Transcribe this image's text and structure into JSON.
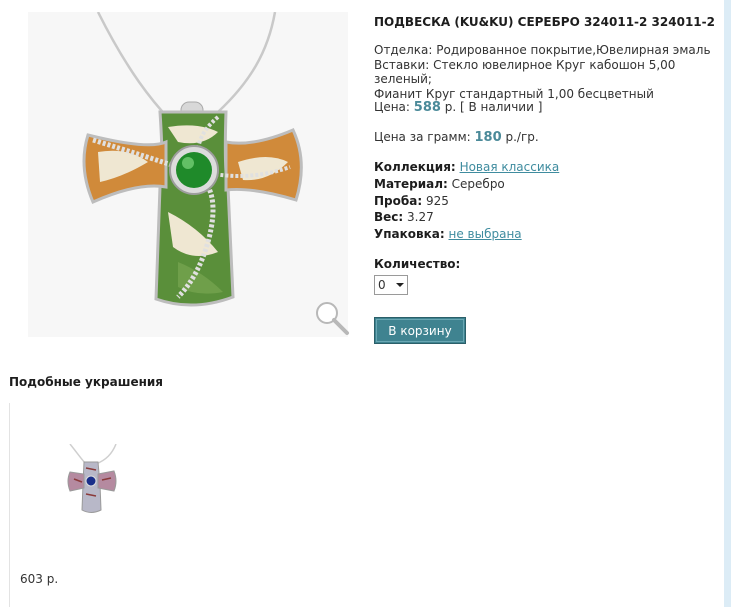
{
  "product": {
    "title": "ПОДВЕСКА (KU&KU) СЕРЕБРО 324011-2 324011-2",
    "finish_line": "Отделка: Родированное покрытие,Ювелирная эмаль",
    "inserts_line1": "Вставки: Стекло ювелирное Круг кабошон 5,00 зеленый;",
    "inserts_line2": "Фианит Круг стандартный 1,00 бесцветный",
    "price_label": "Цена:",
    "price_value": "588",
    "price_suffix": "р. [ В наличии ]",
    "per_gram_label": "Цена за грамм:",
    "per_gram_value": "180",
    "per_gram_suffix": "р./гр.",
    "props": {
      "collection_label": "Коллекция:",
      "collection_value": "Новая классика",
      "material_label": "Материал:",
      "material_value": "Серебро",
      "probe_label": "Проба:",
      "probe_value": "925",
      "weight_label": "Вес:",
      "weight_value": "3.27",
      "packaging_label": "Упаковка:",
      "packaging_value": "не выбрана"
    },
    "quantity_label": "Количество:",
    "quantity_value": "0",
    "cart_button": "В корзину"
  },
  "similar": {
    "title": "Подобные украшения",
    "items": [
      {
        "price": "603 р."
      }
    ]
  },
  "colors": {
    "accent": "#3f8390",
    "link": "#3f8c9f",
    "price": "#4b8a99",
    "stripe": "#dcecf6"
  },
  "icons": [
    "magnifier-zoom-icon",
    "dropdown-arrow-icon"
  ]
}
